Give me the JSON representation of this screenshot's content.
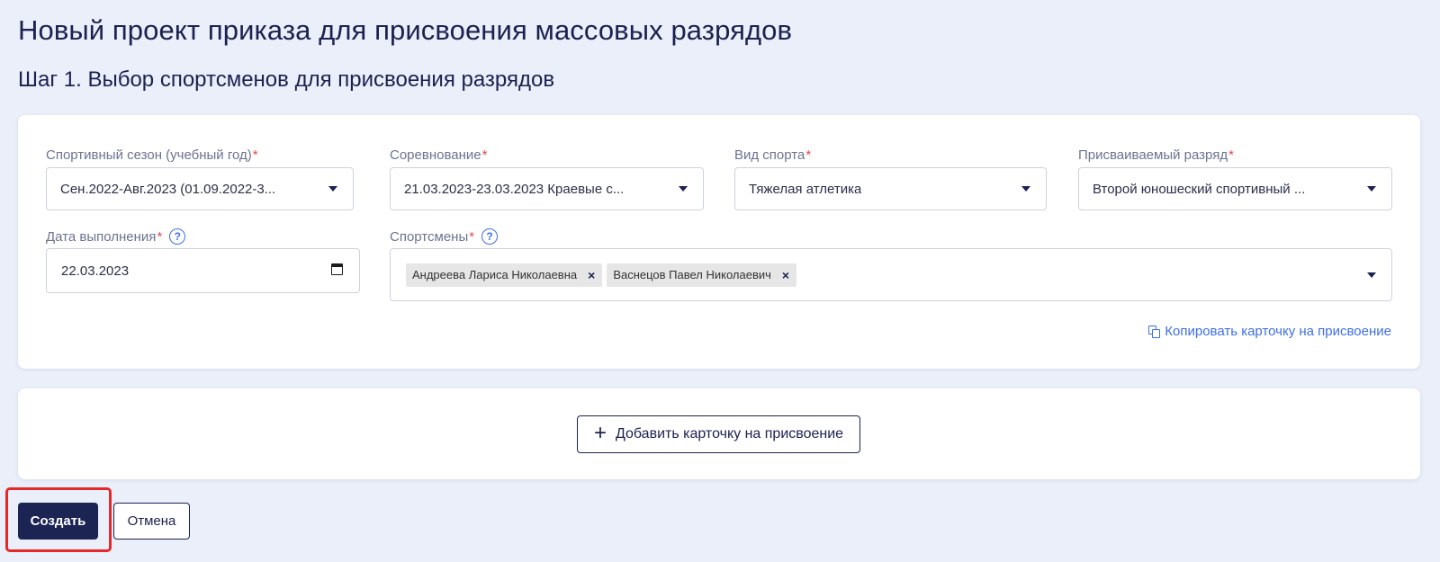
{
  "page": {
    "title": "Новый проект приказа для присвоения массовых разрядов",
    "step_title": "Шаг 1. Выбор спортсменов для присвоения разрядов"
  },
  "form": {
    "season": {
      "label": "Спортивный сезон (учебный год)",
      "required_mark": "*",
      "value": "Сен.2022-Авг.2023 (01.09.2022-3..."
    },
    "competition": {
      "label": "Соревнование",
      "required_mark": "*",
      "value": "21.03.2023-23.03.2023 Краевые с..."
    },
    "sport": {
      "label": "Вид спорта",
      "required_mark": "*",
      "value": "Тяжелая атлетика"
    },
    "rank": {
      "label": "Присваиваемый разряд",
      "required_mark": "*",
      "value": "Второй юношеский спортивный ..."
    },
    "completion_date": {
      "label": "Дата выполнения",
      "required_mark": "*",
      "help_glyph": "?",
      "value": "22.03.2023"
    },
    "athletes": {
      "label": "Спортсмены",
      "required_mark": "*",
      "help_glyph": "?",
      "chips": [
        {
          "label": "Андреева Лариса Николаевна",
          "remove_glyph": "×"
        },
        {
          "label": "Васнецов Павел Николаевич",
          "remove_glyph": "×"
        }
      ]
    },
    "copy_card_link": "Копировать карточку на присвоение"
  },
  "add_card": {
    "plus_glyph": "+",
    "label": "Добавить карточку на присвоение"
  },
  "actions": {
    "create_label": "Создать",
    "cancel_label": "Отмена"
  },
  "colors": {
    "background": "#eaeff9",
    "primary": "#1c2453",
    "link": "#3d6fe6",
    "required": "#e5484d",
    "highlight": "#e5282b"
  }
}
